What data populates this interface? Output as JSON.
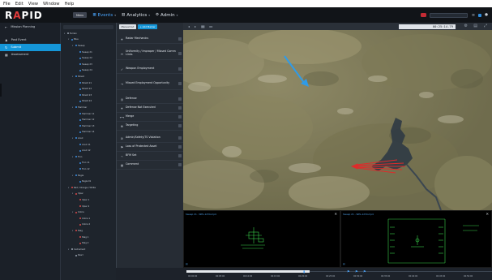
{
  "os_menu": [
    "File",
    "Edit",
    "View",
    "Window",
    "Help"
  ],
  "app": {
    "logo_prefix": "R",
    "logo_accent": "A",
    "logo_suffix": "PID",
    "view_chip": "Menu",
    "nav": [
      {
        "label": "Events",
        "active": true
      },
      {
        "label": "Analytics",
        "active": false
      },
      {
        "label": "Admin",
        "active": false
      }
    ]
  },
  "sidebar": {
    "back_label": "Mission Planning",
    "items": [
      {
        "label": "Post Event",
        "active": false,
        "icon": "user-icon"
      },
      {
        "label": "Submit",
        "active": true,
        "icon": "refresh-icon"
      },
      {
        "label": "Assessment",
        "active": false,
        "icon": "grid-icon"
      }
    ]
  },
  "tree": {
    "rows": [
      {
        "indent": 0,
        "label": "Terrain",
        "color": "#9aa4b0",
        "toggle": "▾"
      },
      {
        "indent": 1,
        "label": "Blue",
        "color": "#3a8ee6",
        "toggle": "▾"
      },
      {
        "indent": 2,
        "label": "Sweep",
        "color": "#3a8ee6",
        "toggle": "▾"
      },
      {
        "indent": 3,
        "label": "Sweep 21",
        "color": "#3a8ee6",
        "toggle": ""
      },
      {
        "indent": 3,
        "label": "Sweep 22",
        "color": "#3a8ee6",
        "toggle": ""
      },
      {
        "indent": 3,
        "label": "Sweep 23",
        "color": "#3a8ee6",
        "toggle": ""
      },
      {
        "indent": 3,
        "label": "Sweep 24",
        "color": "#3a8ee6",
        "toggle": ""
      },
      {
        "indent": 2,
        "label": "Shield",
        "color": "#3a8ee6",
        "toggle": "▾"
      },
      {
        "indent": 3,
        "label": "Shield 21",
        "color": "#3a8ee6",
        "toggle": ""
      },
      {
        "indent": 3,
        "label": "Shield 22",
        "color": "#3a8ee6",
        "toggle": ""
      },
      {
        "indent": 3,
        "label": "Shield 23",
        "color": "#3a8ee6",
        "toggle": ""
      },
      {
        "indent": 3,
        "label": "Shield 24",
        "color": "#3a8ee6",
        "toggle": ""
      },
      {
        "indent": 2,
        "label": "Hammer",
        "color": "#3a8ee6",
        "toggle": "▾"
      },
      {
        "indent": 3,
        "label": "Hammer 11",
        "color": "#3a8ee6",
        "toggle": ""
      },
      {
        "indent": 3,
        "label": "Hammer 12",
        "color": "#3a8ee6",
        "toggle": ""
      },
      {
        "indent": 3,
        "label": "Hammer 13",
        "color": "#3a8ee6",
        "toggle": ""
      },
      {
        "indent": 3,
        "label": "Hammer 14",
        "color": "#3a8ee6",
        "toggle": ""
      },
      {
        "indent": 2,
        "label": "Anvil",
        "color": "#3a8ee6",
        "toggle": "▾"
      },
      {
        "indent": 3,
        "label": "Anvil 11",
        "color": "#3a8ee6",
        "toggle": ""
      },
      {
        "indent": 3,
        "label": "Anvil 12",
        "color": "#3a8ee6",
        "toggle": ""
      },
      {
        "indent": 2,
        "label": "Tron",
        "color": "#3a8ee6",
        "toggle": "▾"
      },
      {
        "indent": 3,
        "label": "Tron 11",
        "color": "#3a8ee6",
        "toggle": ""
      },
      {
        "indent": 3,
        "label": "Tron 12",
        "color": "#3a8ee6",
        "toggle": ""
      },
      {
        "indent": 2,
        "label": "Eagle",
        "color": "#3a8ee6",
        "toggle": "▾"
      },
      {
        "indent": 3,
        "label": "Eagle 01",
        "color": "#3a8ee6",
        "toggle": ""
      },
      {
        "indent": 1,
        "label": "Red / Orange / White",
        "color": "#d94848",
        "toggle": "▾"
      },
      {
        "indent": 2,
        "label": "Viper",
        "color": "#d94848",
        "toggle": "▾"
      },
      {
        "indent": 3,
        "label": "Viper 1",
        "color": "#d94848",
        "toggle": ""
      },
      {
        "indent": 3,
        "label": "Viper 2",
        "color": "#d94848",
        "toggle": ""
      },
      {
        "indent": 2,
        "label": "Cobra",
        "color": "#d94848",
        "toggle": "▾"
      },
      {
        "indent": 3,
        "label": "Cobra 1",
        "color": "#d94848",
        "toggle": ""
      },
      {
        "indent": 3,
        "label": "Cobra 2",
        "color": "#d94848",
        "toggle": ""
      },
      {
        "indent": 2,
        "label": "Stag",
        "color": "#d94848",
        "toggle": "▾"
      },
      {
        "indent": 3,
        "label": "Stag 1",
        "color": "#d94848",
        "toggle": ""
      },
      {
        "indent": 3,
        "label": "Stag 2",
        "color": "#d94848",
        "toggle": ""
      },
      {
        "indent": 1,
        "label": "Instrument",
        "color": "#9aa4b0",
        "toggle": "▾"
      },
      {
        "indent": 2,
        "label": "Pearl",
        "color": "#9aa4b0",
        "toggle": ""
      }
    ]
  },
  "tasks": {
    "buttons": [
      {
        "label": "Manual Cut",
        "style": "light"
      },
      {
        "label": "+ Add Marker",
        "style": "blue"
      }
    ],
    "rows": [
      {
        "label": "Radar Mechanics",
        "icon": "✈",
        "tall": false
      },
      {
        "label": "Uniformity / Improper / Missed Comm Links",
        "icon": "↔",
        "tall": true
      },
      {
        "label": "Weapon Employment",
        "icon": "✓",
        "tall": false
      },
      {
        "label": "Missed Employment Opportunity",
        "icon": "→",
        "tall": true
      },
      {
        "label": "Defense",
        "icon": "◎",
        "tall": false
      },
      {
        "label": "Defense Not Executed",
        "icon": "✈",
        "tall": false
      },
      {
        "label": "Merge",
        "icon": "⟷",
        "tall": false
      },
      {
        "label": "Targeting",
        "icon": "⊕",
        "tall": false
      },
      {
        "label": "Admin/Safety/TS Violation",
        "icon": "⊘",
        "tall": false
      },
      {
        "label": "Loss of Protected Asset",
        "icon": "⚑",
        "tall": false
      },
      {
        "label": "BFM Set",
        "icon": "⌁",
        "tall": false
      },
      {
        "label": "Comment",
        "icon": "▤",
        "tall": false
      }
    ]
  },
  "map_toolbar": {
    "time": "00:25:14.79"
  },
  "videos": [
    {
      "title": "Sweep 21 - WPL-1234.mp4",
      "close": "✕"
    },
    {
      "title": "Sweep 21 - WPL-1234.mp4",
      "close": "✕"
    }
  ],
  "timeline": {
    "ticks": [
      "00:00:00",
      "00:05:00",
      "00:10:00",
      "00:15:00",
      "00:20:00",
      "00:25:00",
      "00:30:00",
      "00:35:00",
      "00:40:00",
      "00:45:00",
      "00:50:00"
    ]
  },
  "colors": {
    "accent": "#1596d8",
    "blue_track": "#2f9be8",
    "red_track": "#e02a2a",
    "hud_green": "#39d14b"
  }
}
